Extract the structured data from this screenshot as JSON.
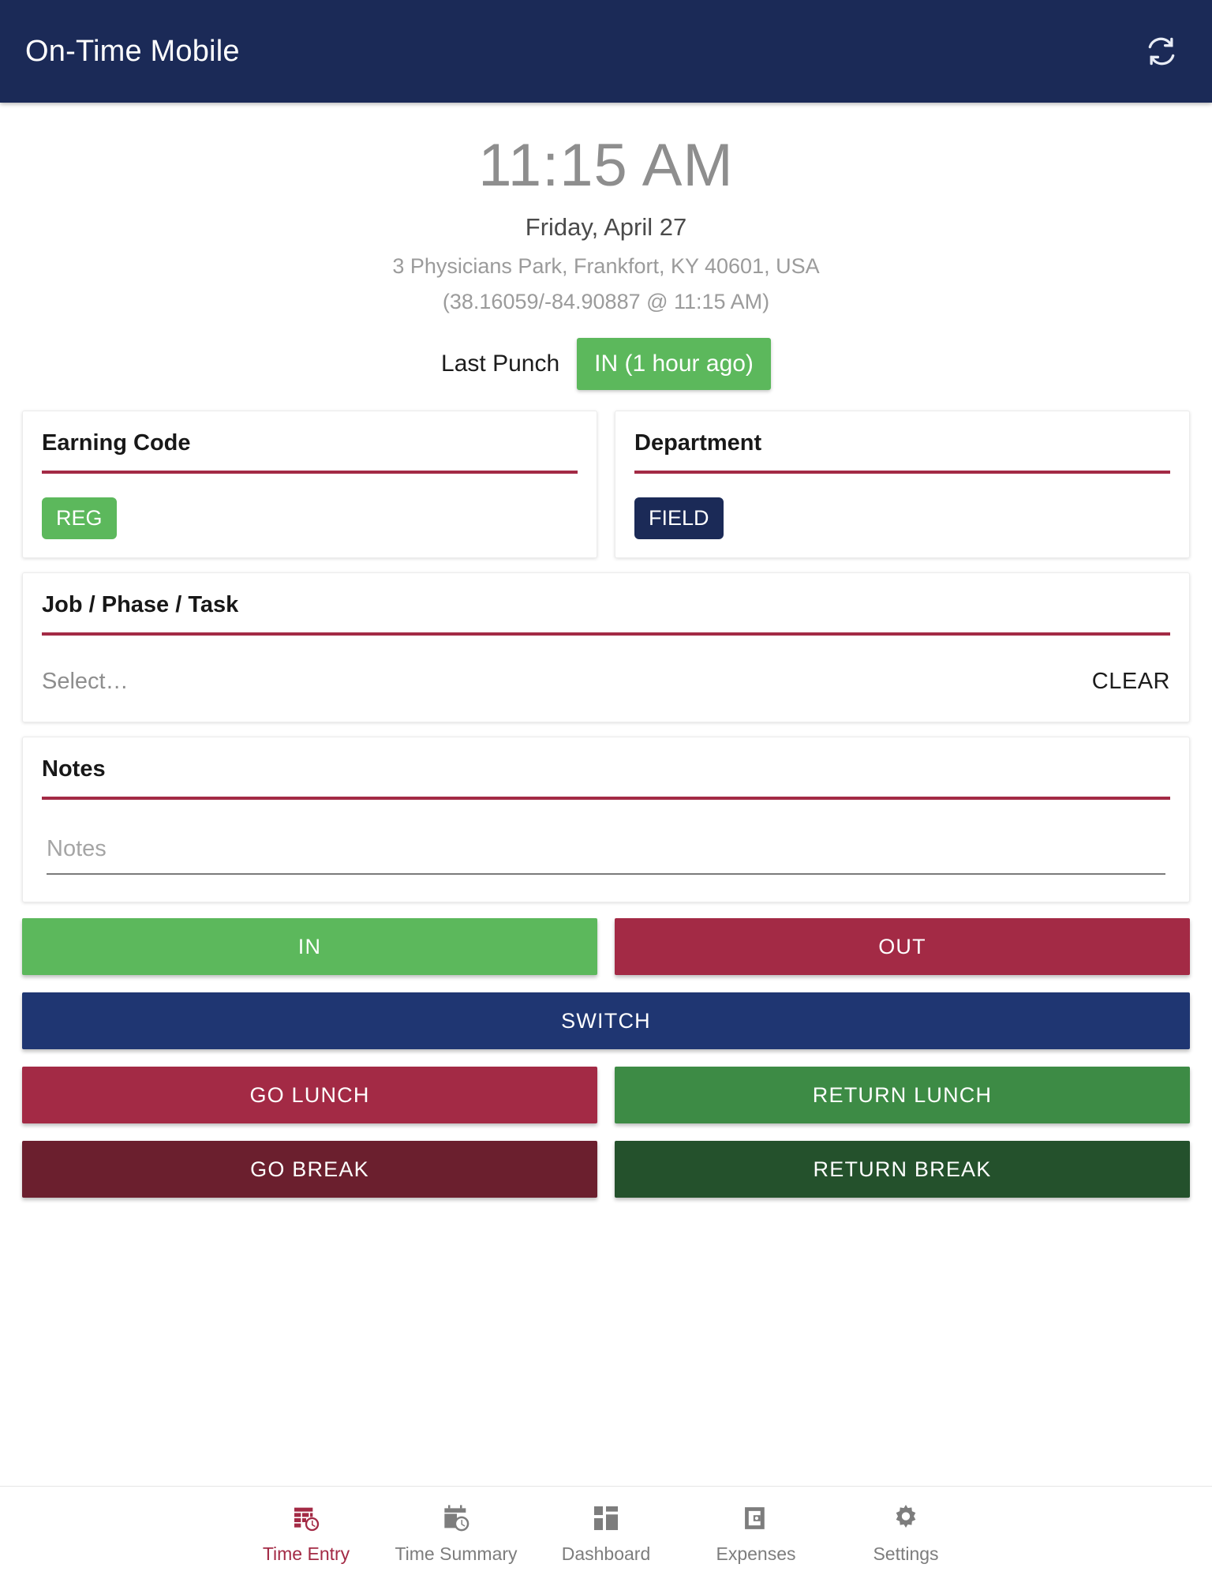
{
  "header": {
    "title": "On-Time Mobile",
    "sync_icon": "refresh-sync-icon"
  },
  "clock": {
    "time": "11:15 AM",
    "date": "Friday, April 27",
    "address": "3 Physicians Park, Frankfort, KY 40601, USA",
    "coordinates": "(38.16059/-84.90887 @ 11:15 AM)"
  },
  "last_punch": {
    "label": "Last Punch",
    "badge": "IN (1 hour ago)",
    "badge_color": "#5cb85c"
  },
  "earning_code": {
    "title": "Earning Code",
    "chip": "REG",
    "chip_color": "#5cb85c"
  },
  "department": {
    "title": "Department",
    "chip": "FIELD",
    "chip_color": "#1b2a57"
  },
  "job_phase_task": {
    "title": "Job / Phase / Task",
    "placeholder": "Select…",
    "clear_label": "CLEAR"
  },
  "notes": {
    "title": "Notes",
    "placeholder": "Notes",
    "value": ""
  },
  "buttons": {
    "in": "IN",
    "out": "OUT",
    "switch": "SWITCH",
    "go_lunch": "GO LUNCH",
    "return_lunch": "RETURN LUNCH",
    "go_break": "GO BREAK",
    "return_break": "RETURN BREAK"
  },
  "colors": {
    "header_navy": "#1b2a57",
    "accent_crimson": "#a32a45",
    "green": "#5cb85c",
    "switch_blue": "#1f3672",
    "dark_green": "#24512c",
    "dark_red": "#6b1f2e"
  },
  "bottom_nav": {
    "active_index": 0,
    "items": [
      {
        "label": "Time Entry",
        "icon": "calendar-clock-icon"
      },
      {
        "label": "Time Summary",
        "icon": "calendar-clock-outline-icon"
      },
      {
        "label": "Dashboard",
        "icon": "dashboard-grid-icon"
      },
      {
        "label": "Expenses",
        "icon": "wallet-icon"
      },
      {
        "label": "Settings",
        "icon": "gear-icon"
      }
    ]
  }
}
